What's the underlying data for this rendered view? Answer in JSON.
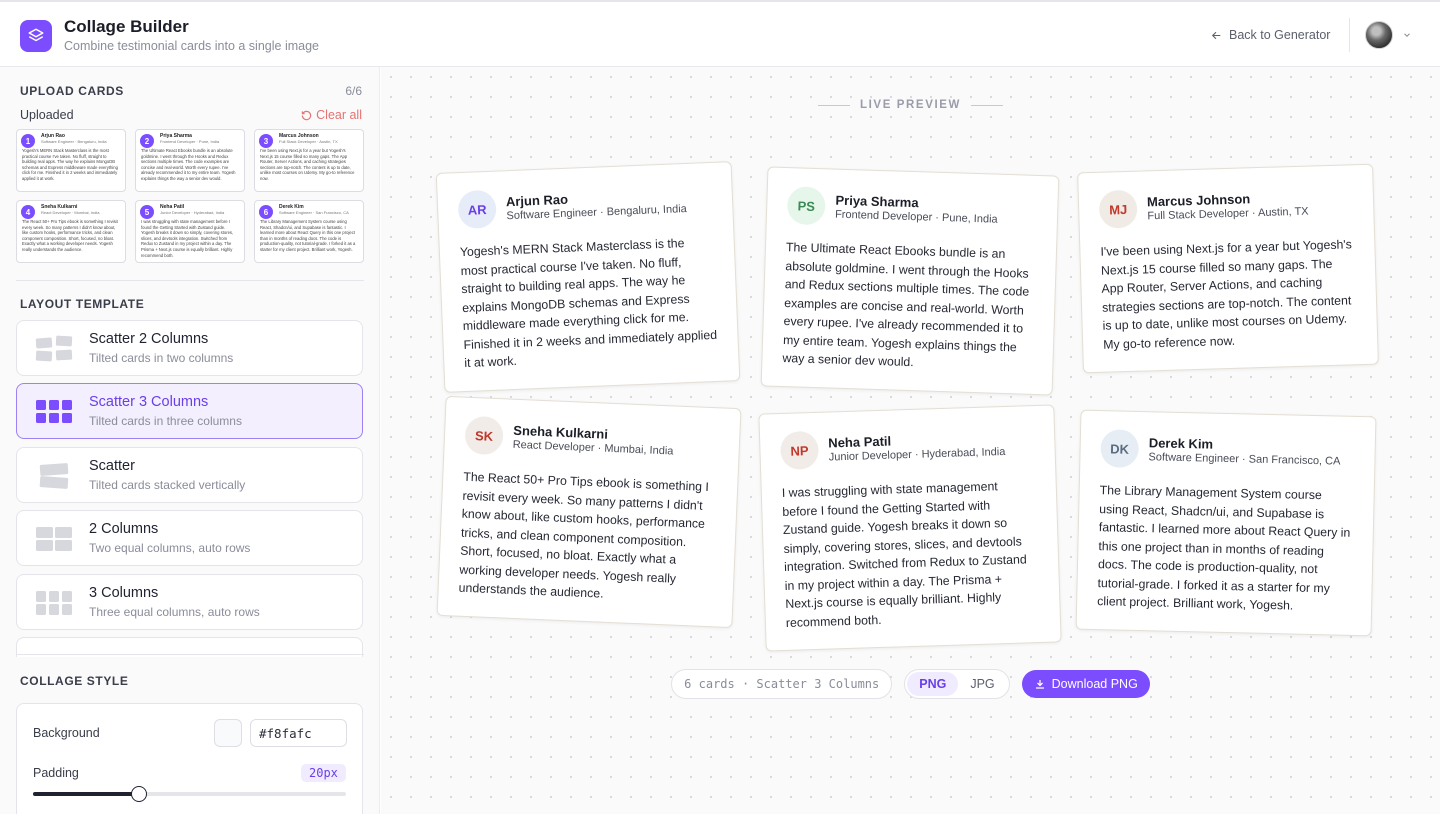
{
  "header": {
    "title": "Collage Builder",
    "subtitle": "Combine testimonial cards into a single image",
    "back_label": "Back to Generator"
  },
  "upload": {
    "section_title": "UPLOAD CARDS",
    "count": "6/6",
    "uploaded_label": "Uploaded",
    "clear_label": "Clear all",
    "thumbs": [
      {
        "num": "1",
        "name": "Arjun Rao",
        "role": "Software Engineer · Bengaluru, India",
        "text": "Yogesh's MERN Stack Masterclass is the most practical course I've taken. No fluff, straight to building real apps. The way he explains MongoDB schemas and Express middleware made everything click for me. Finished it in 2 weeks and immediately applied it at work."
      },
      {
        "num": "2",
        "name": "Priya Sharma",
        "role": "Frontend Developer · Pune, India",
        "text": "The Ultimate React Ebooks bundle is an absolute goldmine. I went through the Hooks and Redux sections multiple times. The code examples are concise and real-world. Worth every rupee. I've already recommended it to my entire team. Yogesh explains things the way a senior dev would."
      },
      {
        "num": "3",
        "name": "Marcus Johnson",
        "role": "Full Stack Developer · Austin, TX",
        "text": "I've been using Next.js for a year but Yogesh's Next.js 15 course filled so many gaps. The App Router, Server Actions, and caching strategies sections are top-notch. The content is up to date, unlike most courses on Udemy. My go-to reference now."
      },
      {
        "num": "4",
        "name": "Sneha Kulkarni",
        "role": "React Developer · Mumbai, India",
        "text": "The React 50+ Pro Tips ebook is something I revisit every week. So many patterns I didn't know about, like custom hooks, performance tricks, and clean component composition. Short, focused, no bloat. Exactly what a working developer needs. Yogesh really understands the audience."
      },
      {
        "num": "5",
        "name": "Neha Patil",
        "role": "Junior Developer · Hyderabad, India",
        "text": "I was struggling with state management before I found the Getting Started with Zustand guide. Yogesh breaks it down so simply, covering stores, slices, and devtools integration. Switched from Redux to Zustand in my project within a day. The Prisma + Next.js course is equally brilliant. Highly recommend both."
      },
      {
        "num": "6",
        "name": "Derek Kim",
        "role": "Software Engineer · San Francisco, CA",
        "text": "The Library Management System course using React, Shadcn/ui, and Supabase is fantastic. I learned more about React Query in this one project than in months of reading docs. The code is production-quality, not tutorial-grade. I forked it as a starter for my client project. Brilliant work, Yogesh."
      }
    ]
  },
  "layout": {
    "section_title": "LAYOUT TEMPLATE",
    "templates": [
      {
        "title": "Scatter 2 Columns",
        "desc": "Tilted cards in two columns"
      },
      {
        "title": "Scatter 3 Columns",
        "desc": "Tilted cards in three columns"
      },
      {
        "title": "Scatter",
        "desc": "Tilted cards stacked vertically"
      },
      {
        "title": "2 Columns",
        "desc": "Two equal columns, auto rows"
      },
      {
        "title": "3 Columns",
        "desc": "Three equal columns, auto rows"
      }
    ]
  },
  "style": {
    "section_title": "COLLAGE STYLE",
    "background_label": "Background",
    "background_value": "#f8fafc",
    "padding_label": "Padding",
    "padding_value": "20px",
    "padding_fraction": 0.34
  },
  "preview": {
    "label": "LIVE PREVIEW",
    "cards": [
      {
        "initials": "AR",
        "name": "Arjun Rao",
        "role": "Software Engineer · Bengaluru, India",
        "text": "Yogesh's MERN Stack Masterclass is the most practical course I've taken. No fluff, straight to building real apps. The way he explains MongoDB schemas and Express middleware made everything click for me. Finished it in 2 weeks and immediately applied it at work.",
        "avatar_bg": "#e6edf8",
        "avatar_fg": "#6a3fe8"
      },
      {
        "initials": "PS",
        "name": "Priya Sharma",
        "role": "Frontend Developer · Pune, India",
        "text": "The Ultimate React Ebooks bundle is an absolute goldmine. I went through the Hooks and Redux sections multiple times. The code examples are concise and real-world. Worth every rupee. I've already recommended it to my entire team. Yogesh explains things the way a senior dev would.",
        "avatar_bg": "#e6f6ea",
        "avatar_fg": "#3b8a55"
      },
      {
        "initials": "MJ",
        "name": "Marcus Johnson",
        "role": "Full Stack Developer · Austin, TX",
        "text": "I've been using Next.js for a year but Yogesh's Next.js 15 course filled so many gaps. The App Router, Server Actions, and caching strategies sections are top-notch. The content is up to date, unlike most courses on Udemy. My go-to reference now.",
        "avatar_bg": "#f1ebe6",
        "avatar_fg": "#c0392b"
      },
      {
        "initials": "SK",
        "name": "Sneha Kulkarni",
        "role": "React Developer · Mumbai, India",
        "text": "The React 50+ Pro Tips ebook is something I revisit every week. So many patterns I didn't know about, like custom hooks, performance tricks, and clean component composition. Short, focused, no bloat. Exactly what a working developer needs. Yogesh really understands the audience.",
        "avatar_bg": "#f1ece8",
        "avatar_fg": "#c0392b"
      },
      {
        "initials": "NP",
        "name": "Neha Patil",
        "role": "Junior Developer · Hyderabad, India",
        "text": "I was struggling with state management before I found the Getting Started with Zustand guide. Yogesh breaks it down so simply, covering stores, slices, and devtools integration. Switched from Redux to Zustand in my project within a day. The Prisma + Next.js course is equally brilliant. Highly recommend both.",
        "avatar_bg": "#f1ece8",
        "avatar_fg": "#c0392b"
      },
      {
        "initials": "DK",
        "name": "Derek Kim",
        "role": "Software Engineer · San Francisco, CA",
        "text": "The Library Management System course using React, Shadcn/ui, and Supabase is fantastic. I learned more about React Query in this one project than in months of reading docs. The code is production-quality, not tutorial-grade. I forked it as a starter for my client project. Brilliant work, Yogesh.",
        "avatar_bg": "#e6edf5",
        "avatar_fg": "#5b6b80"
      }
    ],
    "info": "6 cards · Scatter 3 Columns",
    "format_png": "PNG",
    "format_jpg": "JPG",
    "download_label": "Download PNG"
  },
  "colors": {
    "accent": "#7c4dff",
    "danger": "#e57373"
  }
}
